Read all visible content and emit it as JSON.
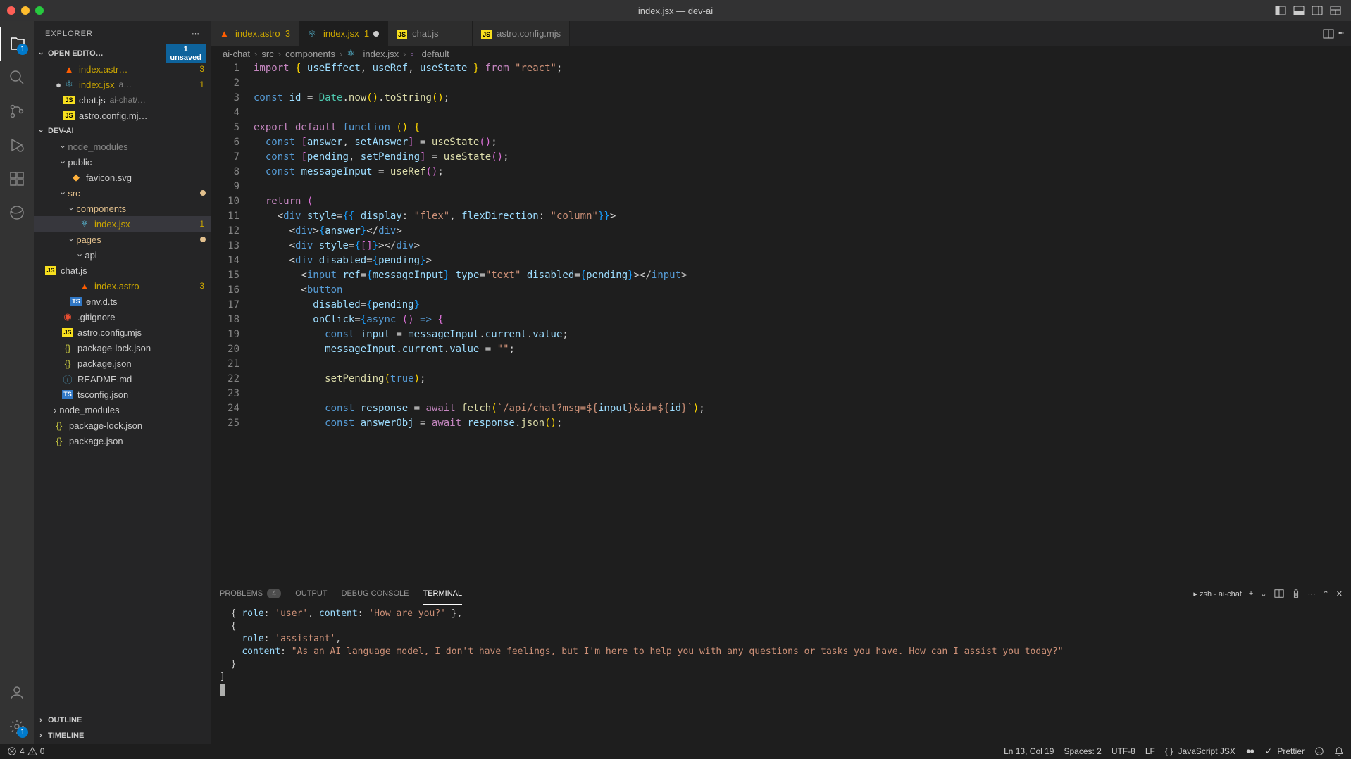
{
  "window": {
    "title": "index.jsx — dev-ai"
  },
  "activitybar": {
    "explorer_badge": "1",
    "settings_badge": "1"
  },
  "sidebar": {
    "title": "EXPLORER",
    "open_editors_label": "OPEN EDITO…",
    "unsaved_count": "1",
    "unsaved_label": "unsaved",
    "open_editors": [
      {
        "name": "index.astr…",
        "badge": "3",
        "icon": "astro",
        "warn": true
      },
      {
        "name": "index.jsx",
        "path": "a…",
        "badge": "1",
        "icon": "react",
        "warn": true,
        "modified": true
      },
      {
        "name": "chat.js",
        "path": "ai-chat/…",
        "icon": "js"
      },
      {
        "name": "astro.config.mj…",
        "icon": "js"
      }
    ],
    "project_name": "DEV-AI",
    "tree": [
      {
        "name": "node_modules",
        "level": 1,
        "dim": true,
        "folder": true,
        "collapsed": false
      },
      {
        "name": "public",
        "level": 1,
        "folder": true
      },
      {
        "name": "favicon.svg",
        "level": 2,
        "icon": "svg"
      },
      {
        "name": "src",
        "level": 1,
        "folder": true,
        "dot": true,
        "mod": true
      },
      {
        "name": "components",
        "level": 2,
        "folder": true,
        "mod": true
      },
      {
        "name": "index.jsx",
        "level": 3,
        "icon": "react",
        "badge": "1",
        "warn": true,
        "active": true
      },
      {
        "name": "pages",
        "level": 2,
        "folder": true,
        "dot": true,
        "mod": true
      },
      {
        "name": "api",
        "level": 3,
        "folder": true
      },
      {
        "name": "chat.js",
        "level": 4,
        "icon": "js"
      },
      {
        "name": "index.astro",
        "level": 3,
        "icon": "astro",
        "badge": "3",
        "warn": true
      },
      {
        "name": "env.d.ts",
        "level": 2,
        "icon": "ts"
      },
      {
        "name": ".gitignore",
        "level": 1,
        "icon": "git"
      },
      {
        "name": "astro.config.mjs",
        "level": 1,
        "icon": "js"
      },
      {
        "name": "package-lock.json",
        "level": 1,
        "icon": "json"
      },
      {
        "name": "package.json",
        "level": 1,
        "icon": "json"
      },
      {
        "name": "README.md",
        "level": 1,
        "icon": "md"
      },
      {
        "name": "tsconfig.json",
        "level": 1,
        "icon": "ts"
      },
      {
        "name": "node_modules",
        "level": 0,
        "folder": true,
        "collapsed": true
      },
      {
        "name": "package-lock.json",
        "level": 0,
        "icon": "json"
      },
      {
        "name": "package.json",
        "level": 0,
        "icon": "json"
      }
    ],
    "outline_label": "OUTLINE",
    "timeline_label": "TIMELINE"
  },
  "tabs": [
    {
      "name": "index.astro",
      "badge": "3",
      "icon": "astro"
    },
    {
      "name": "index.jsx",
      "badge": "1",
      "icon": "react",
      "active": true,
      "modified": true
    },
    {
      "name": "chat.js",
      "icon": "js"
    },
    {
      "name": "astro.config.mjs",
      "icon": "js"
    }
  ],
  "breadcrumb": [
    "ai-chat",
    "src",
    "components",
    "index.jsx",
    "default"
  ],
  "code": {
    "lines": [
      {
        "n": 1,
        "html": "<span class='kw'>import</span> <span class='brace'>{</span> <span class='var'>useEffect</span>, <span class='var'>useRef</span>, <span class='var'>useState</span> <span class='brace'>}</span> <span class='kw'>from</span> <span class='str'>\"react\"</span>;"
      },
      {
        "n": 2,
        "html": ""
      },
      {
        "n": 3,
        "html": "<span class='const-kw'>const</span> <span class='var'>id</span> = <span class='type'>Date</span>.<span class='fn'>now</span><span class='brace'>()</span>.<span class='fn'>toString</span><span class='brace'>()</span>;"
      },
      {
        "n": 4,
        "html": ""
      },
      {
        "n": 5,
        "html": "<span class='kw'>export</span> <span class='kw'>default</span> <span class='const-kw'>function</span> <span class='brace'>()</span> <span class='brace'>{</span>"
      },
      {
        "n": 6,
        "html": "  <span class='const-kw'>const</span> <span class='paren'>[</span><span class='var'>answer</span>, <span class='var'>setAnswer</span><span class='paren'>]</span> = <span class='fn'>useState</span><span class='paren'>()</span>;"
      },
      {
        "n": 7,
        "html": "  <span class='const-kw'>const</span> <span class='paren'>[</span><span class='var'>pending</span>, <span class='var'>setPending</span><span class='paren'>]</span> = <span class='fn'>useState</span><span class='paren'>()</span>;"
      },
      {
        "n": 8,
        "html": "  <span class='const-kw'>const</span> <span class='var'>messageInput</span> = <span class='fn'>useRef</span><span class='paren'>()</span>;"
      },
      {
        "n": 9,
        "html": ""
      },
      {
        "n": 10,
        "html": "  <span class='kw'>return</span> <span class='paren'>(</span>"
      },
      {
        "n": 11,
        "html": "    &lt;<span class='tag'>div</span> <span class='attr'>style</span>=<span class='sq'>{{</span> <span class='var'>display</span>: <span class='str'>\"flex\"</span>, <span class='var'>flexDirection</span>: <span class='str'>\"column\"</span><span class='sq'>}}</span>&gt;"
      },
      {
        "n": 12,
        "html": "      &lt;<span class='tag'>div</span>&gt;<span class='sq'>{</span><span class='var'>answer</span><span class='sq'>}</span>&lt;/<span class='tag'>div</span>&gt;"
      },
      {
        "n": 13,
        "html": "      &lt;<span class='tag'>div</span> <span class='attr'>style</span>=<span class='sq'>{</span><span class='paren'>[]</span><span class='sq'>}</span>&gt;&lt;/<span class='tag'>div</span>&gt;"
      },
      {
        "n": 14,
        "html": "      &lt;<span class='tag'>div</span> <span class='attr'>disabled</span>=<span class='sq'>{</span><span class='var'>pending</span><span class='sq'>}</span>&gt;"
      },
      {
        "n": 15,
        "html": "        &lt;<span class='tag'>input</span> <span class='attr'>ref</span>=<span class='sq'>{</span><span class='var'>messageInput</span><span class='sq'>}</span> <span class='attr'>type</span>=<span class='str'>\"text\"</span> <span class='attr'>disabled</span>=<span class='sq'>{</span><span class='var'>pending</span><span class='sq'>}</span>&gt;&lt;/<span class='tag'>input</span>&gt;"
      },
      {
        "n": 16,
        "html": "        &lt;<span class='tag'>button</span>"
      },
      {
        "n": 17,
        "html": "          <span class='attr'>disabled</span>=<span class='sq'>{</span><span class='var'>pending</span><span class='sq'>}</span>"
      },
      {
        "n": 18,
        "html": "          <span class='attr'>onClick</span>=<span class='sq'>{</span><span class='const-kw'>async</span> <span class='paren'>()</span> <span class='const-kw'>=&gt;</span> <span class='paren'>{</span>"
      },
      {
        "n": 19,
        "html": "            <span class='const-kw'>const</span> <span class='var'>input</span> = <span class='var'>messageInput</span>.<span class='var'>current</span>.<span class='var'>value</span>;"
      },
      {
        "n": 20,
        "html": "            <span class='var'>messageInput</span>.<span class='var'>current</span>.<span class='var'>value</span> = <span class='str'>\"\"</span>;"
      },
      {
        "n": 21,
        "html": ""
      },
      {
        "n": 22,
        "html": "            <span class='fn'>setPending</span><span class='brace'>(</span><span class='const-kw'>true</span><span class='brace'>)</span>;"
      },
      {
        "n": 23,
        "html": ""
      },
      {
        "n": 24,
        "html": "            <span class='const-kw'>const</span> <span class='var'>response</span> = <span class='kw'>await</span> <span class='fn'>fetch</span><span class='brace'>(</span><span class='str'>`/api/chat?msg=${</span><span class='var'>input</span><span class='str'>}&amp;id=${</span><span class='var'>id</span><span class='str'>}`</span><span class='brace'>)</span>;"
      },
      {
        "n": 25,
        "html": "            <span class='const-kw'>const</span> <span class='var'>answerObj</span> = <span class='kw'>await</span> <span class='var'>response</span>.<span class='fn'>json</span><span class='brace'>()</span>;"
      }
    ]
  },
  "panel": {
    "tabs": {
      "problems": "PROBLEMS",
      "problems_count": "4",
      "output": "OUTPUT",
      "debug": "DEBUG CONSOLE",
      "terminal": "TERMINAL"
    },
    "shell": "zsh - ai-chat",
    "terminal": "  { role: 'user', content: 'How are you?' },\n  {\n    role: 'assistant',\n    content: \"As an AI language model, I don't have feelings, but I'm here to help you with any questions or tasks you have. How can I assist you today?\"\n  }\n]"
  },
  "status": {
    "errors": "4",
    "warnings": "0",
    "cursor": "Ln 13, Col 19",
    "spaces": "Spaces: 2",
    "encoding": "UTF-8",
    "eol": "LF",
    "lang": "JavaScript JSX",
    "prettier": "Prettier"
  }
}
